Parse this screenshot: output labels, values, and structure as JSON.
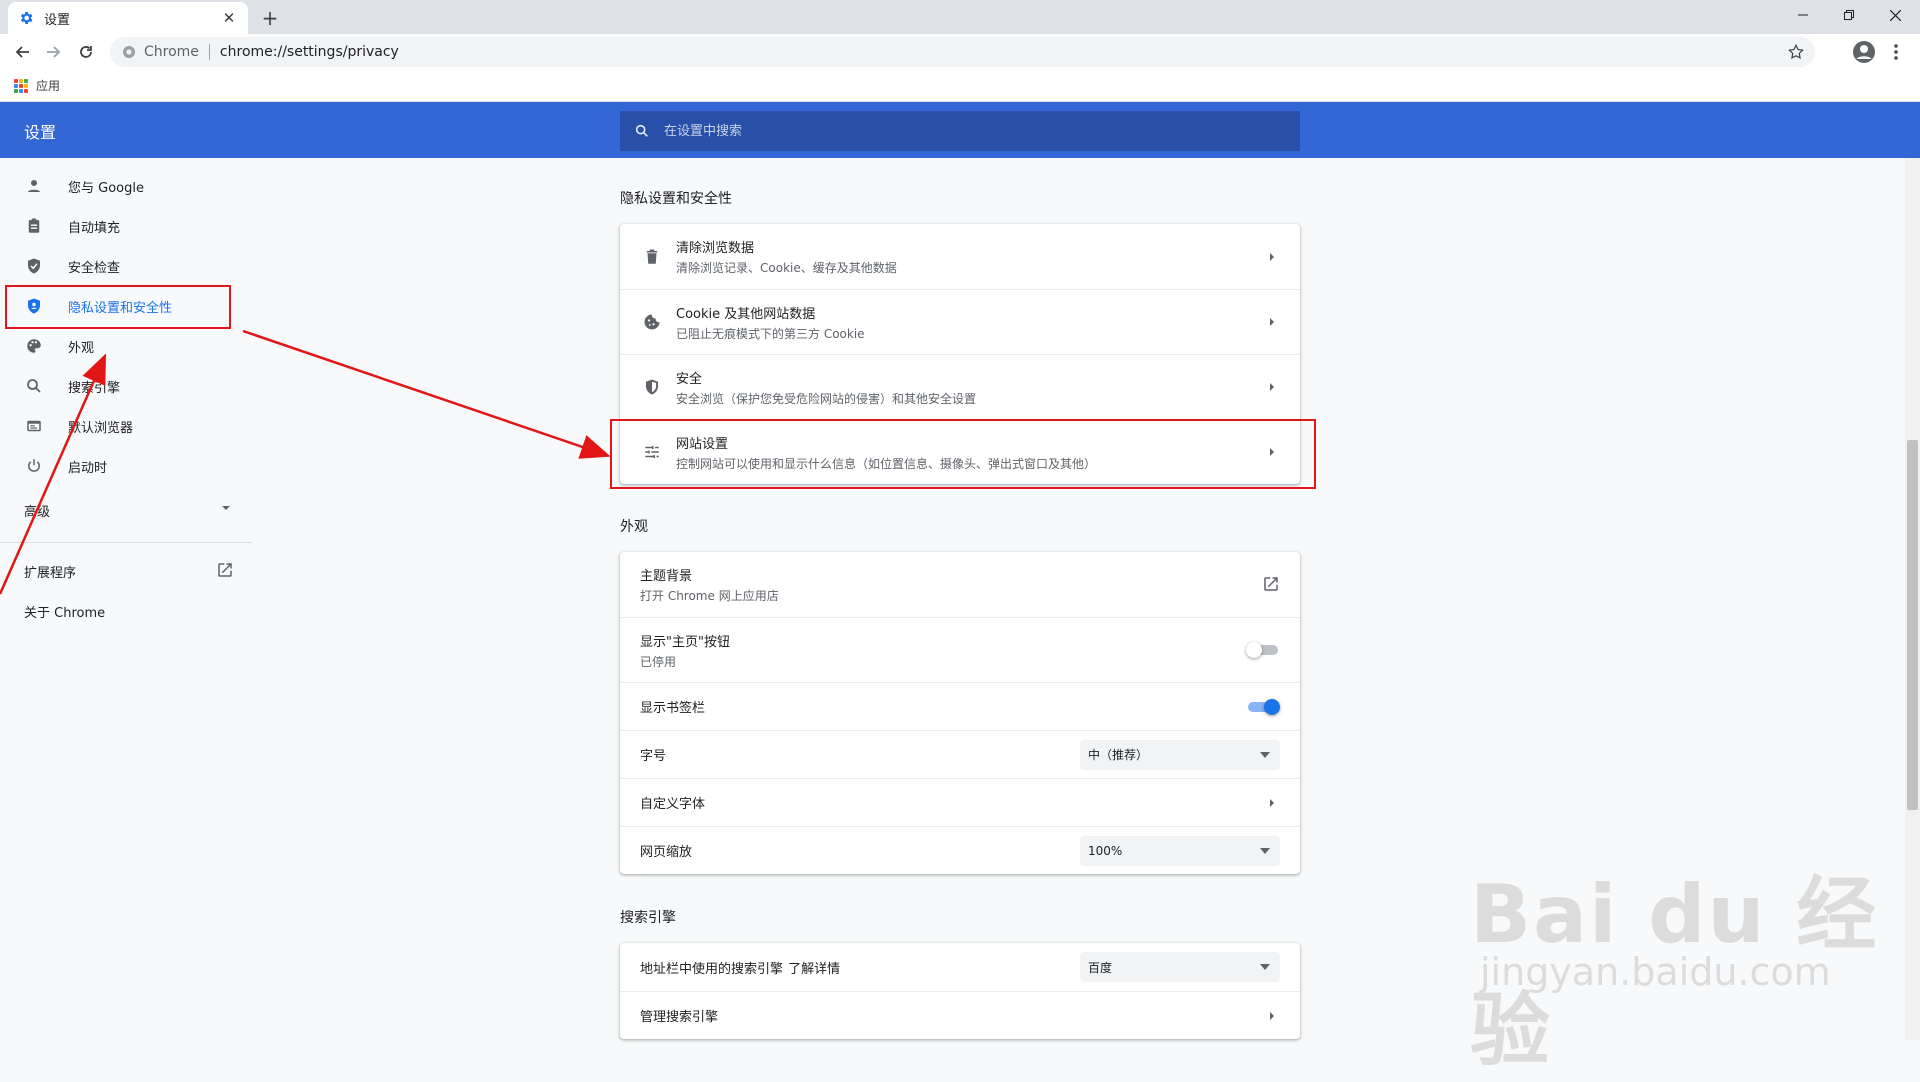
{
  "browser": {
    "tab_title": "设置",
    "scheme_label": "Chrome",
    "url": "chrome://settings/privacy",
    "bookmark_apps": "应用"
  },
  "header": {
    "title": "设置",
    "search_placeholder": "在设置中搜索"
  },
  "sidebar": {
    "items": [
      {
        "label": "您与 Google",
        "icon": "person-icon"
      },
      {
        "label": "自动填充",
        "icon": "clipboard-icon"
      },
      {
        "label": "安全检查",
        "icon": "shield-check-icon"
      },
      {
        "label": "隐私设置和安全性",
        "icon": "shield-privacy-icon",
        "active": true
      },
      {
        "label": "外观",
        "icon": "palette-icon"
      },
      {
        "label": "搜索引擎",
        "icon": "search-icon"
      },
      {
        "label": "默认浏览器",
        "icon": "browser-icon"
      },
      {
        "label": "启动时",
        "icon": "power-icon"
      }
    ],
    "advanced": "高级",
    "extensions": "扩展程序",
    "about": "关于 Chrome"
  },
  "privacy": {
    "section_title": "隐私设置和安全性",
    "rows": [
      {
        "primary": "清除浏览数据",
        "secondary": "清除浏览记录、Cookie、缓存及其他数据",
        "icon": "trash-icon"
      },
      {
        "primary": "Cookie 及其他网站数据",
        "secondary": "已阻止无痕模式下的第三方 Cookie",
        "icon": "cookie-icon"
      },
      {
        "primary": "安全",
        "secondary": "安全浏览（保护您免受危险网站的侵害）和其他安全设置",
        "icon": "shield-icon"
      },
      {
        "primary": "网站设置",
        "secondary": "控制网站可以使用和显示什么信息（如位置信息、摄像头、弹出式窗口及其他）",
        "icon": "sliders-icon"
      }
    ]
  },
  "appearance": {
    "section_title": "外观",
    "theme": {
      "primary": "主题背景",
      "secondary": "打开 Chrome 网上应用店"
    },
    "home_button": {
      "primary": "显示\"主页\"按钮",
      "secondary": "已停用",
      "enabled": false
    },
    "bookmarks_bar": {
      "primary": "显示书签栏",
      "enabled": true
    },
    "font_size": {
      "label": "字号",
      "value": "中（推荐）"
    },
    "custom_fonts": {
      "label": "自定义字体"
    },
    "page_zoom": {
      "label": "网页缩放",
      "value": "100%"
    }
  },
  "search_engine": {
    "section_title": "搜索引擎",
    "used": {
      "label": "地址栏中使用的搜索引擎",
      "link": "了解详情",
      "value": "百度"
    },
    "manage": {
      "label": "管理搜索引擎"
    }
  },
  "watermark": {
    "brand": "Bai du 经验",
    "site": "jingyan.baidu.com"
  },
  "colors": {
    "header_blue": "#3367d6",
    "accent_blue": "#1a73e8",
    "annotation_red": "#e21616"
  }
}
